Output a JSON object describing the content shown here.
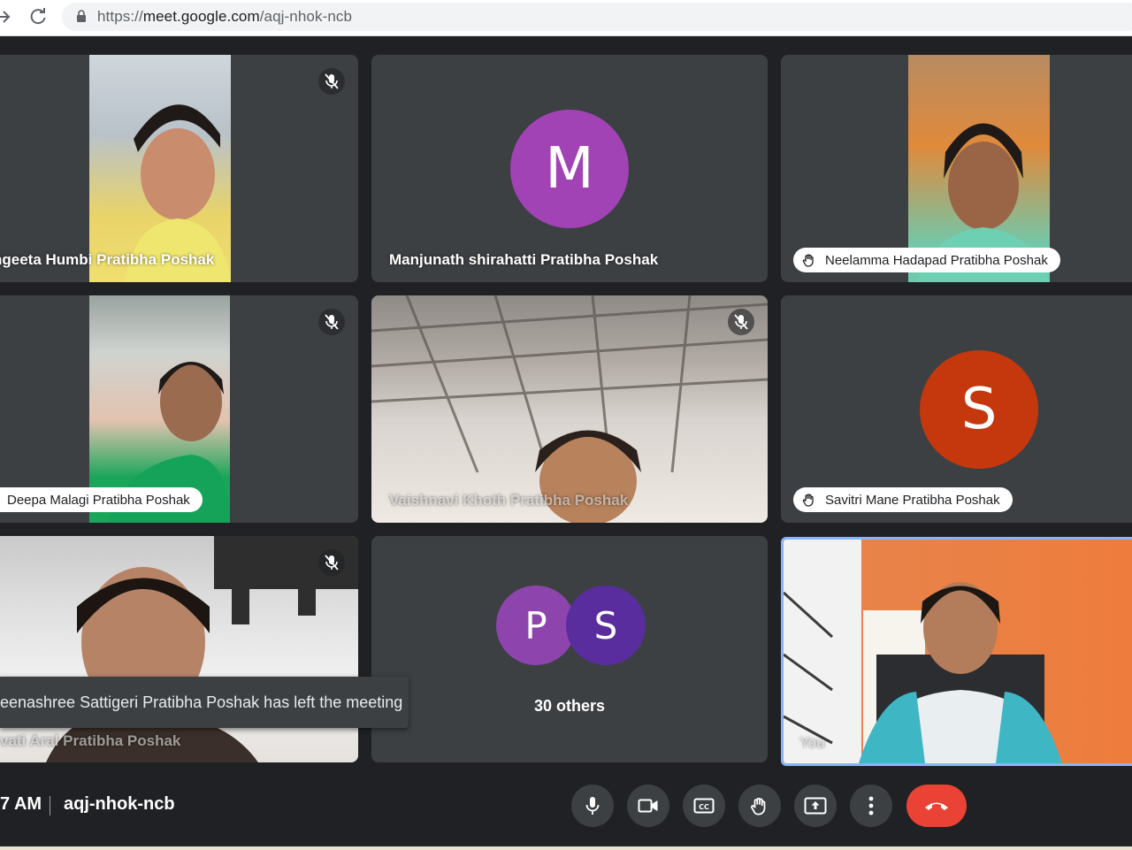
{
  "browser": {
    "url_prefix": "https://",
    "url_host": "meet.google.com",
    "url_path": "/aqj-nhok-ncb"
  },
  "tiles": [
    {
      "name": "ngeeta Humbi Pratibha Poshak",
      "muted": true
    },
    {
      "name": "Manjunath shirahatti Pratibha Poshak",
      "avatar_letter": "M",
      "avatar_color": "#a142b5"
    },
    {
      "name": "Neelamma Hadapad Pratibha Poshak",
      "hand_raised": true
    },
    {
      "name": "Deepa Malagi Pratibha Poshak",
      "hand_raised": true,
      "muted": true
    },
    {
      "name": "Vaishnavi Khoth Pratibha Poshak",
      "muted": true
    },
    {
      "name": "Savitri Mane Pratibha Poshak",
      "hand_raised": true,
      "avatar_letter": "S",
      "avatar_color": "#c5380d"
    },
    {
      "name": "vati Aral Pratibha Poshak",
      "muted": true
    },
    {
      "others_label": "30 others",
      "avatars": [
        {
          "letter": "P",
          "color": "#8e44ad"
        },
        {
          "letter": "S",
          "color": "#5a2d9e"
        }
      ]
    },
    {
      "name": "You",
      "self": true,
      "highlight_color": "#8ab4f8"
    }
  ],
  "toast": {
    "text": "eenashree Sattigeri Pratibha Poshak has left the meeting"
  },
  "bottom_bar": {
    "time": "7 AM",
    "meeting_code": "aqj-nhok-ncb",
    "controls": [
      "mic-icon",
      "camera-icon",
      "captions-icon",
      "raise-hand-icon",
      "present-icon",
      "more-options-icon",
      "leave-call-icon"
    ],
    "leave_color": "#ea4335"
  }
}
